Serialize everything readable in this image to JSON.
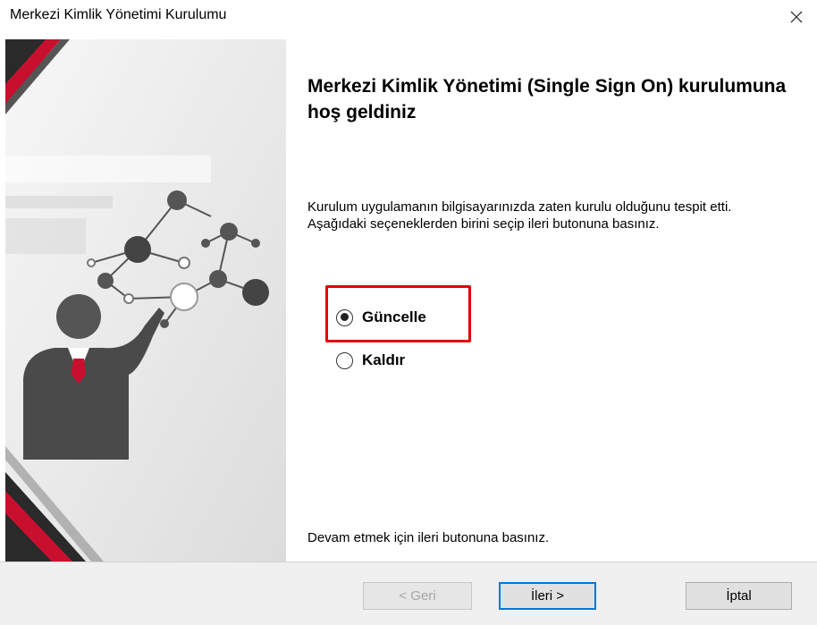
{
  "window": {
    "title": "Merkezi Kimlik Yönetimi Kurulumu"
  },
  "content": {
    "heading": "Merkezi Kimlik Yönetimi (Single Sign On) kurulumuna hoş geldiniz",
    "description": "Kurulum uygulamanın bilgisayarınızda zaten kurulu olduğunu tespit etti. Aşağıdaki seçeneklerden birini seçip ileri butonuna basınız.",
    "options": [
      {
        "label": "Güncelle",
        "selected": true
      },
      {
        "label": "Kaldır",
        "selected": false
      }
    ],
    "footer": "Devam etmek için ileri butonuna basınız."
  },
  "buttons": {
    "back": "< Geri",
    "next": "İleri >",
    "cancel": "İptal"
  },
  "icons": {
    "close": "close-icon",
    "illustration": "network-presenter-illustration"
  },
  "colors": {
    "highlight": "#e00000",
    "accent_red": "#c8102e",
    "focus_blue": "#0078d7"
  }
}
